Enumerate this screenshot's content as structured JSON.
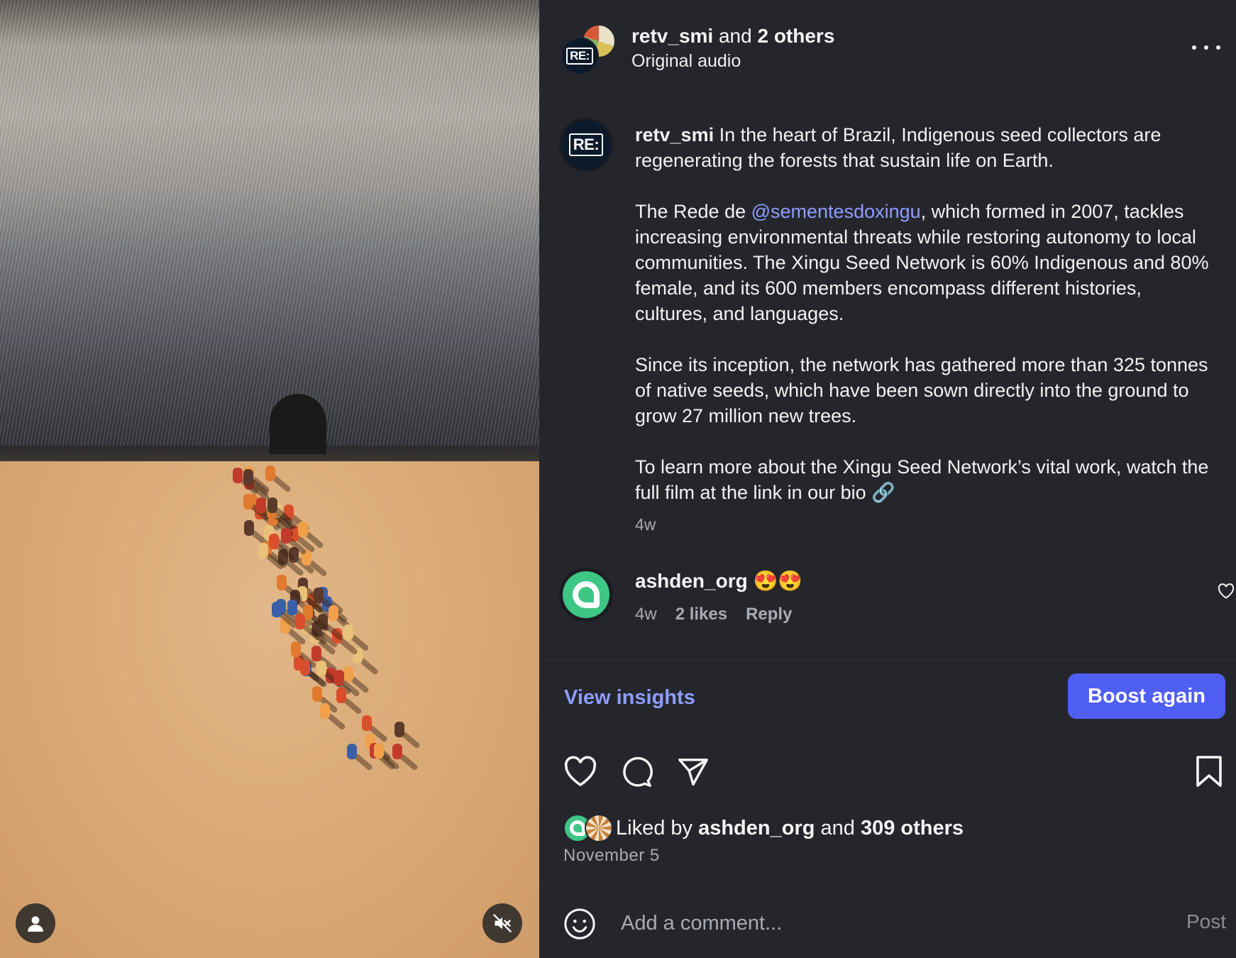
{
  "header": {
    "username": "retv_smi",
    "and_text": " and ",
    "others": "2 others",
    "subtitle": "Original audio",
    "avatar_logo": "RE:"
  },
  "caption": {
    "username": "retv_smi",
    "intro": " In the heart of Brazil, Indigenous seed collectors are regenerating the forests that sustain life on Earth.",
    "p2_before": "The Rede de ",
    "p2_mention": "@sementesdoxingu",
    "p2_after": ", which formed in 2007, tackles increasing environmental threats while restoring autonomy to local communities. The Xingu Seed Network is 60% Indigenous and 80% female, and its 600 members encompass different histories, cultures, and languages.",
    "p3": "Since its inception, the network has gathered more than 325 tonnes of native seeds, which have been sown directly into the ground to grow 27 million new trees.",
    "p4": "To learn more about the Xingu Seed Network’s vital work, watch the full film at the link in our bio 🔗",
    "time": "4w"
  },
  "comment": {
    "username": "ashden_org",
    "text": " 😍😍",
    "time": "4w",
    "likes": "2 likes",
    "reply": "Reply"
  },
  "insights": {
    "view_label": "View insights",
    "boost_label": "Boost again"
  },
  "likes": {
    "prefix": "Liked by ",
    "user": "ashden_org",
    "mid": " and ",
    "others": "309 others",
    "date": "November 5"
  },
  "add_comment": {
    "placeholder": "Add a comment...",
    "post_label": "Post"
  },
  "icons": [
    "user-icon",
    "muted-speaker-icon",
    "more-icon",
    "heart-icon",
    "comment-icon",
    "share-icon",
    "bookmark-icon",
    "emoji-icon"
  ],
  "colors": {
    "accent": "#4f5ef3",
    "link": "#8f9cff",
    "panel_bg": "#24262c"
  }
}
